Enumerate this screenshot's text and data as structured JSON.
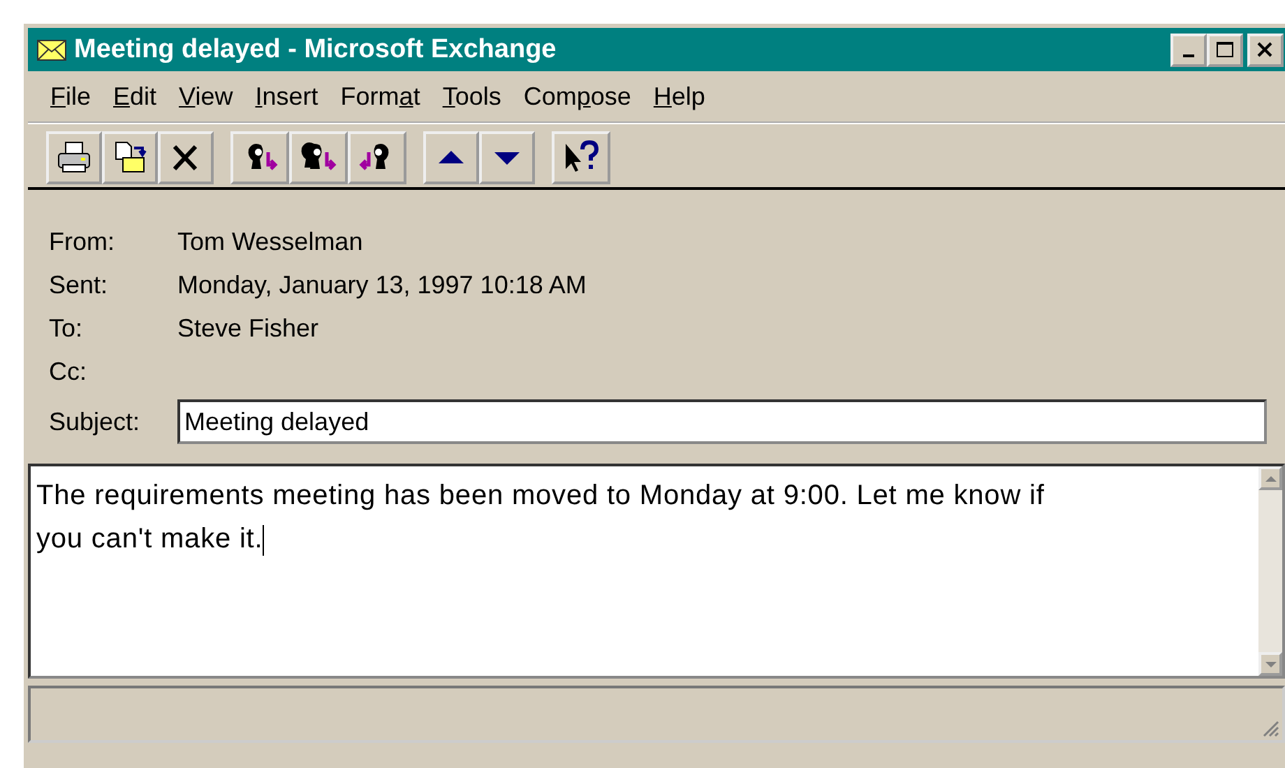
{
  "window": {
    "title": "Meeting delayed - Microsoft Exchange"
  },
  "menu": [
    {
      "key": "F",
      "after": "ile"
    },
    {
      "key": "E",
      "after": "dit"
    },
    {
      "key": "V",
      "after": "iew"
    },
    {
      "key": "I",
      "after": "nsert"
    },
    {
      "before": "Form",
      "key": "a",
      "after": "t"
    },
    {
      "key": "T",
      "after": "ools"
    },
    {
      "before": "Com",
      "key": "p",
      "after": "ose"
    },
    {
      "key": "H",
      "after": "elp"
    }
  ],
  "toolbar": [
    [
      {
        "kind": "print"
      },
      {
        "kind": "move"
      },
      {
        "kind": "delete"
      }
    ],
    [
      {
        "kind": "reply"
      },
      {
        "kind": "reply_all"
      },
      {
        "kind": "forward"
      }
    ],
    [
      {
        "kind": "previous"
      },
      {
        "kind": "next"
      }
    ],
    [
      {
        "kind": "help"
      }
    ]
  ],
  "header": [
    {
      "label": "From:",
      "value": "Tom Wesselman"
    },
    {
      "label": "Sent:",
      "value": "Monday, January 13, 1997 10:18 AM"
    },
    {
      "label": "To:",
      "value": "Steve Fisher"
    },
    {
      "label": "Cc:"
    }
  ],
  "subject": {
    "label": "Subject:",
    "value": "Meeting delayed"
  },
  "body": {
    "text": "The requirements meeting has been moved to Monday at 9:00. Let me know if you can't make it."
  }
}
